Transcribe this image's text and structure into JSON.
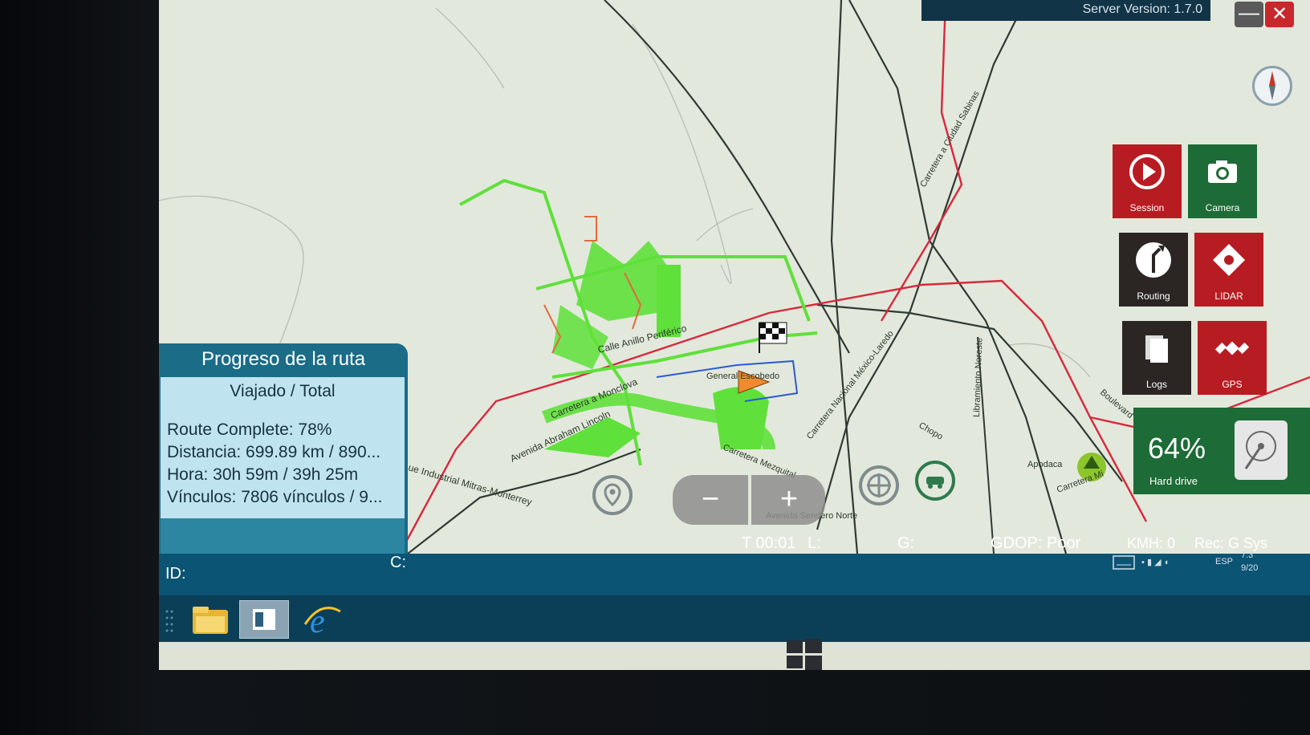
{
  "window": {
    "server_version": "Server Version: 1.7.0",
    "minimize_label": "—",
    "close_label": "✕"
  },
  "map": {
    "labels": [
      "Calle Anillo Periférico",
      "Carretera a Monclova",
      "Avenida Abraham Lincoln",
      "General Escobedo",
      "Carretera Mezquital",
      "Carretera Nacional México-Laredo",
      "Libramiento Noreste",
      "Carretera a Ciudad Sabinas",
      "Chopo",
      "Apodaca",
      "Boulevard",
      "Carretera Mi",
      "Avenida Sendero Norte",
      "ue Industrial Mitras-Monterrey"
    ]
  },
  "tiles": {
    "session": "Session",
    "camera": "Camera",
    "routing": "Routing",
    "lidar": "LIDAR",
    "logs": "Logs",
    "gps": "GPS"
  },
  "hard_drive": {
    "percent": "64%",
    "label": "Hard drive"
  },
  "route_panel": {
    "title": "Progreso de la ruta",
    "subtitle": "Viajado / Total",
    "route_complete": "Route Complete: 78%",
    "distance": "Distancia: 699.89 km / 890...",
    "time": "Hora: 30h 59m / 39h 25m",
    "links": "Vínculos: 7806 vínculos / 9..."
  },
  "status_bar": {
    "timer": "T 00:01",
    "l": "L:",
    "g": "G:",
    "gdop": "GDOP: Poor",
    "kmh": "KMH: 0",
    "rec": "Rec: G Sys",
    "id": "ID:",
    "c": "C:"
  },
  "tray": {
    "lang": "ESP",
    "time": "7:3",
    "date": "9/20"
  },
  "colors": {
    "accent": "#0c5473",
    "route_green": "#5fe03a",
    "road_red": "#d8283c",
    "tile_red": "#b71c22",
    "tile_green": "#1d6b36"
  }
}
